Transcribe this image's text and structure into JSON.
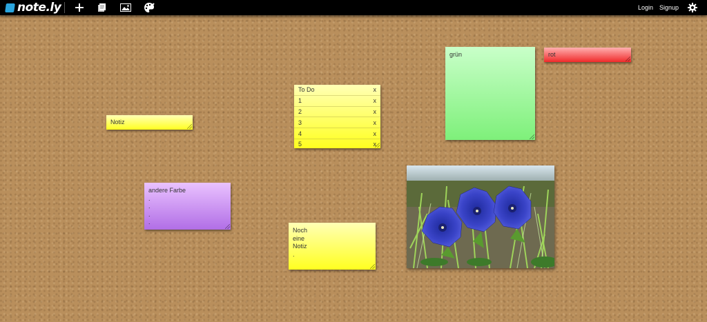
{
  "app": {
    "name": "note.ly"
  },
  "toolbar": {
    "icons": [
      "plus-icon",
      "notes-icon",
      "image-icon",
      "palette-icon"
    ],
    "login_label": "Login",
    "signup_label": "Signup",
    "settings_icon": "gear-icon"
  },
  "colors": {
    "topbar": "#000000",
    "logo_accent": "#2aa5de",
    "cork": "#b98f5c",
    "yellow": "#ffff20",
    "green": "#7ef07a",
    "red": "#f02a2a",
    "purple": "#b16ee6"
  },
  "notes": {
    "notiz": {
      "text": "Notiz",
      "color": "yellow"
    },
    "todo": {
      "title": "To Do",
      "close": "x",
      "items": [
        {
          "label": "1",
          "close": "x"
        },
        {
          "label": "2",
          "close": "x"
        },
        {
          "label": "3",
          "close": "x"
        },
        {
          "label": "4",
          "close": "x"
        },
        {
          "label": "5",
          "close": "x"
        }
      ],
      "color": "yellow"
    },
    "gruen": {
      "text": "grün",
      "color": "green"
    },
    "rot": {
      "text": "rot",
      "color": "red"
    },
    "andere": {
      "text": "andere Farbe\n.\n.\n.\n.",
      "color": "purple"
    },
    "noch": {
      "text": "Noch\neine\nNotiz\n.",
      "color": "yellow"
    }
  },
  "photo": {
    "subject": "blue gentian flowers"
  }
}
